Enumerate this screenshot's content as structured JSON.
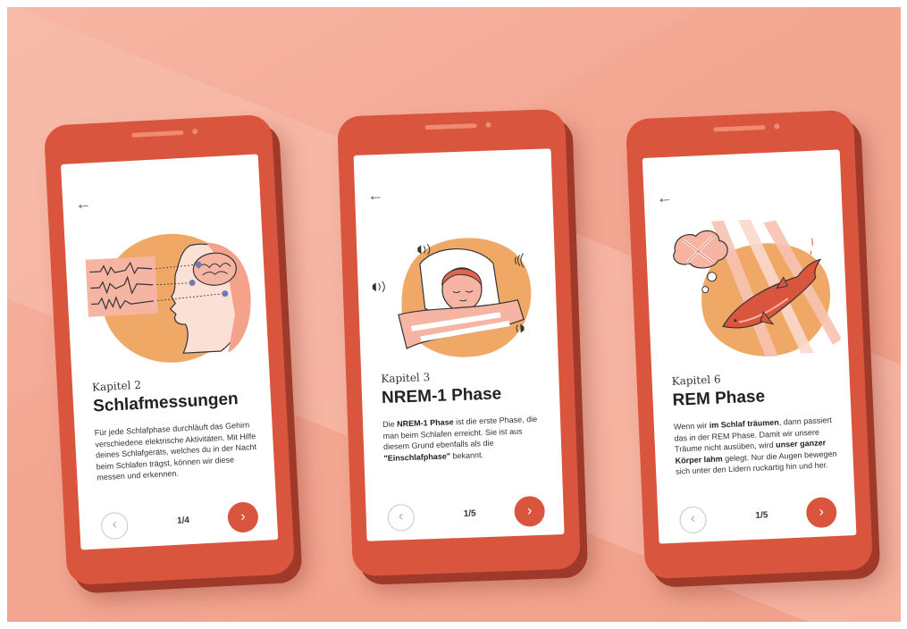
{
  "phones": [
    {
      "chapter": "Kapitel 2",
      "title": "Schlafmessungen",
      "body_parts": [
        {
          "text": "Für jede Schlafphase durchläuft das Gehirn verschiedene elektrische Aktivitäten. Mit Hilfe deines Schlafgeräts, welches du in der Nacht beim Schlafen trägst, können wir diese messen und erkennen."
        }
      ],
      "pager": "1/4",
      "back_glyph": "←",
      "prev_glyph": "‹",
      "next_glyph": "›",
      "illustration": "brain-eeg-illustration"
    },
    {
      "chapter": "Kapitel 3",
      "title": "NREM-1 Phase",
      "body_parts": [
        {
          "text": "Die "
        },
        {
          "text": "NREM-1 Phase",
          "bold": true
        },
        {
          "text": " ist die erste Phase, die man beim Schlafen erreicht. Sie ist aus diesem Grund ebenfalls als die "
        },
        {
          "text": "\"Einschlafphase\"",
          "bold": true
        },
        {
          "text": " bekannt."
        }
      ],
      "pager": "1/5",
      "back_glyph": "←",
      "prev_glyph": "‹",
      "next_glyph": "›",
      "illustration": "sleeping-person-illustration"
    },
    {
      "chapter": "Kapitel 6",
      "title": "REM Phase",
      "body_parts": [
        {
          "text": "Wenn wir "
        },
        {
          "text": "im Schlaf träumen",
          "bold": true
        },
        {
          "text": ", dann passiert das in der REM Phase. Damit wir unsere Träume nicht ausüben, wird "
        },
        {
          "text": "unser ganzer Körper lahm",
          "bold": true
        },
        {
          "text": " gelegt. Nur die Augen bewegen sich unter den Lidern ruckartig hin und her."
        }
      ],
      "pager": "1/5",
      "back_glyph": "←",
      "prev_glyph": "‹",
      "next_glyph": "›",
      "illustration": "dreaming-dolphin-illustration"
    }
  ],
  "colors": {
    "phone_body": "#d9553e",
    "accent": "#d9553e",
    "blob": "#f0a866",
    "skin": "#f6b5a2"
  }
}
